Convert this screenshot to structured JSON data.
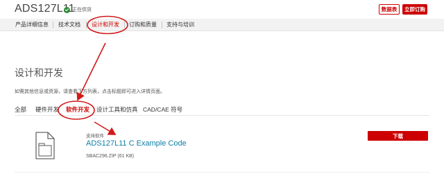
{
  "header": {
    "part_number": "ADS127L11",
    "status_text": "正在供货",
    "datasheet_label": "数据表",
    "order_label": "立即订购"
  },
  "nav": {
    "items": [
      "产品详细信息",
      "技术文档",
      "设计和开发",
      "订购和质量",
      "支持与培训"
    ],
    "active_index": 2
  },
  "section": {
    "title": "设计和开发",
    "description": "如需其他信息或资源，请查看下方列表，点击标题即可进入详情页面。"
  },
  "tabs": {
    "items": [
      "全部",
      "硬件开发",
      "软件开发",
      "设计工具和仿真",
      "CAD/CAE 符号"
    ],
    "active_index": 2
  },
  "resource": {
    "category": "支持软件",
    "title": "ADS127L11 C Example Code",
    "meta": "SBAC296.ZIP (61 KB)",
    "download_label": "下载"
  },
  "colors": {
    "brand_red": "#cc0000",
    "link_teal": "#0a7ea4",
    "annotation_red": "#d11a1a"
  },
  "icons": {
    "status": "check-circle-icon",
    "file": "file-icon"
  }
}
